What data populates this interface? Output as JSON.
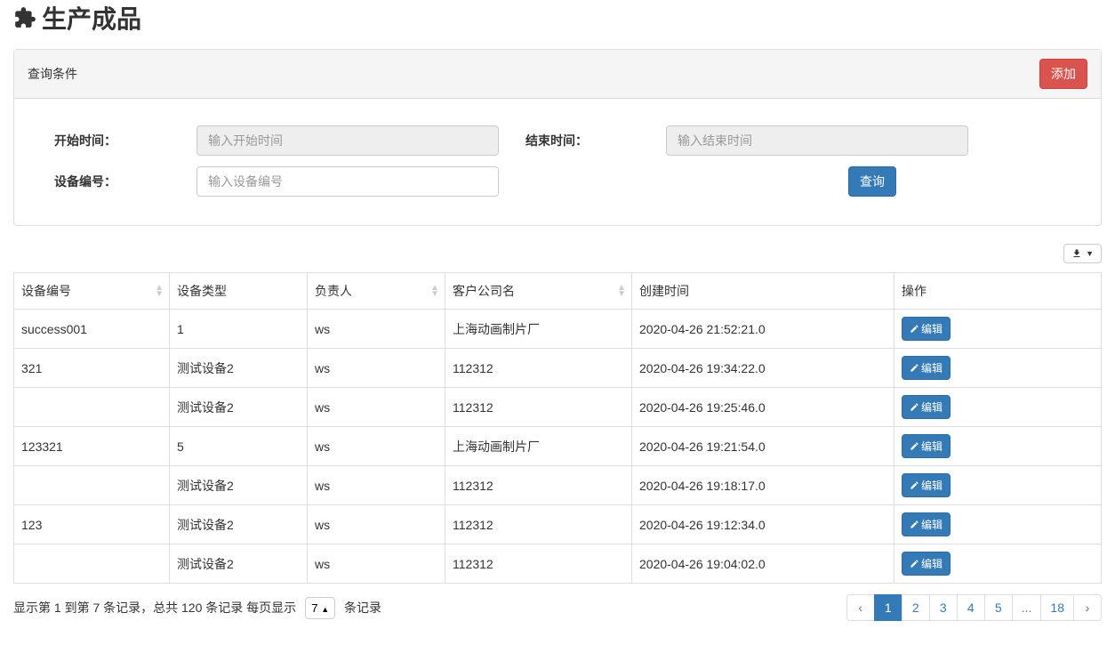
{
  "header": {
    "title": "生产成品"
  },
  "panel": {
    "heading": "查询条件",
    "add_button": "添加"
  },
  "form": {
    "start_time_label": "开始时间：",
    "start_time_placeholder": "输入开始时间",
    "end_time_label": "结束时间：",
    "end_time_placeholder": "输入结束时间",
    "device_no_label": "设备编号：",
    "device_no_placeholder": "输入设备编号",
    "search_button": "查询"
  },
  "table": {
    "columns": {
      "device_no": "设备编号",
      "device_type": "设备类型",
      "owner": "负责人",
      "company": "客户公司名",
      "created_at": "创建时间",
      "action": "操作"
    },
    "edit_label": "编辑",
    "rows": [
      {
        "device_no": "success001",
        "device_type": "1",
        "owner": "ws",
        "company": "上海动画制片厂",
        "created_at": "2020-04-26 21:52:21.0"
      },
      {
        "device_no": "321",
        "device_type": "测试设备2",
        "owner": "ws",
        "company": "112312",
        "created_at": "2020-04-26 19:34:22.0"
      },
      {
        "device_no": "",
        "device_type": "测试设备2",
        "owner": "ws",
        "company": "112312",
        "created_at": "2020-04-26 19:25:46.0"
      },
      {
        "device_no": "123321",
        "device_type": "5",
        "owner": "ws",
        "company": "上海动画制片厂",
        "created_at": "2020-04-26 19:21:54.0"
      },
      {
        "device_no": "",
        "device_type": "测试设备2",
        "owner": "ws",
        "company": "112312",
        "created_at": "2020-04-26 19:18:17.0"
      },
      {
        "device_no": "123",
        "device_type": "测试设备2",
        "owner": "ws",
        "company": "112312",
        "created_at": "2020-04-26 19:12:34.0"
      },
      {
        "device_no": "",
        "device_type": "测试设备2",
        "owner": "ws",
        "company": "112312",
        "created_at": "2020-04-26 19:04:02.0"
      }
    ]
  },
  "footer": {
    "info_prefix": "显示第 1 到第 7 条记录，总共 120 条记录 每页显示",
    "page_size": "7",
    "info_suffix": "条记录"
  },
  "pagination": {
    "prev": "‹",
    "next": "›",
    "pages": [
      "1",
      "2",
      "3",
      "4",
      "5",
      "...",
      "18"
    ],
    "active": "1"
  }
}
